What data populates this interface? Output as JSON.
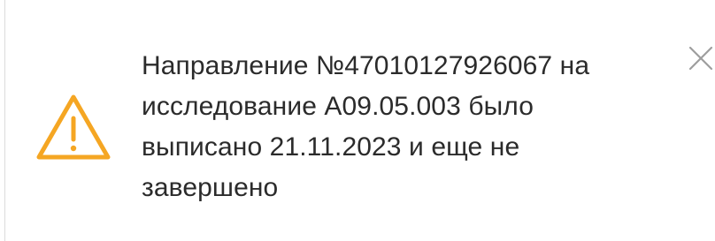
{
  "notification": {
    "type": "warning",
    "icon": "warning-triangle-icon",
    "close_icon": "close-icon",
    "message_lines": [
      "Направление №47010127926067 на",
      "исследование А09.05.003 было",
      "выписано 21.11.2023 и еще не",
      "завершено"
    ],
    "colors": {
      "warning": "#F5A623",
      "text": "#2B2B2B",
      "close": "#9E9E9E"
    }
  }
}
